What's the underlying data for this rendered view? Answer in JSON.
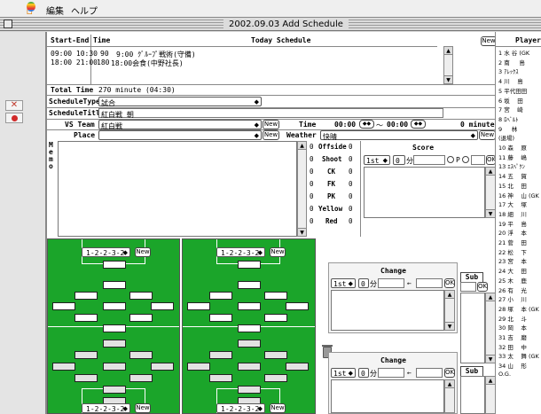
{
  "menubar": {
    "apple_icon": "apple-icon",
    "items": [
      "編集",
      "ヘルプ"
    ]
  },
  "window": {
    "title": "2002.09.03 Add Schedule"
  },
  "schedule_table": {
    "headers": [
      "Start-End",
      "Time",
      "Today Schedule"
    ],
    "new_label": "New",
    "rows": [
      {
        "start_end": "09:00 10:30",
        "time": "90",
        "desc": "9:00 ｸﾞﾙｰﾌﾟ戦術(守備)"
      },
      {
        "start_end": "18:00 21:00",
        "time": "180",
        "desc": "18:00会食(中野社長)"
      }
    ],
    "total_label": "Total Time",
    "total_value": "270 minute (04:30)"
  },
  "form": {
    "schedule_type_label": "ScheduleType",
    "schedule_type_value": "試合",
    "schedule_title_label": "ScheduleTitle",
    "schedule_title_value": "紅白戦 朝",
    "vs_team_label": "VS Team",
    "vs_team_value": "紅白戦",
    "new_label": "New",
    "time_label": "Time",
    "time_start": "00:00",
    "time_sep": "～",
    "time_end": "00:00",
    "minutes": "0 minute",
    "place_label": "Place",
    "place_value": "",
    "weather_label": "Weather",
    "weather_value": "快晴",
    "memo_label": "Memo"
  },
  "stats": [
    {
      "label": "Offside",
      "left": "0",
      "right": "0"
    },
    {
      "label": "Shoot",
      "left": "0",
      "right": "0"
    },
    {
      "label": "CK",
      "left": "0",
      "right": "0"
    },
    {
      "label": "FK",
      "left": "0",
      "right": "0"
    },
    {
      "label": "PK",
      "left": "0",
      "right": "0"
    },
    {
      "label": "Yellow",
      "left": "0",
      "right": "0"
    },
    {
      "label": "Red",
      "left": "0",
      "right": "0"
    }
  ],
  "score": {
    "label": "Score",
    "half": "1st",
    "minute_value": "0",
    "minute_unit": "分",
    "p_label": "P",
    "ok_label": "OK"
  },
  "formations": {
    "left": "1-2-2-3-2",
    "right": "1-2-2-3-2",
    "new_label": "New"
  },
  "sub": {
    "label": "Sub",
    "ok_label": "OK"
  },
  "change": {
    "label": "Change",
    "half": "1st",
    "minute_value": "0",
    "minute_unit": "分",
    "arrow": "←",
    "ok_label": "OK"
  },
  "players": {
    "header": "Player",
    "list": [
      "1 水 谷 (GK",
      "2 南 　 島",
      "3 ｱﾚｯｸｽ",
      "4 川　 島",
      "5 平代田田",
      "6 坂　 田",
      "7 宮　 崎",
      "8 ﾛﾍﾞﾙﾄ",
      "9 　 林",
      "(退場)",
      "10 森　 原",
      "11 藤　 嶋",
      "13 ｴｽﾍﾟｸﾝ",
      "14 五　 賀",
      "15 北　 田",
      "16 神　 山 (GK",
      "17 大　 塚",
      "18 細　 川",
      "19 平　 島",
      "20 浮　 本",
      "21 菅　 田",
      "22 松　 下",
      "23 宮　 本",
      "24 大　 田",
      "25 木　 鹿",
      "26 有　 光",
      "27 小　 川",
      "28 塚　 本 (GK",
      "29 北　 斗",
      "30 岡　 本",
      "31 吉　 磨",
      "32 田　 中",
      "33 太　 舞 (GK",
      "34 山　 形",
      "O.G."
    ]
  },
  "colors": {
    "field": "#1ba52a",
    "window": "#ffffff",
    "chrome": "#d6d6d6"
  }
}
